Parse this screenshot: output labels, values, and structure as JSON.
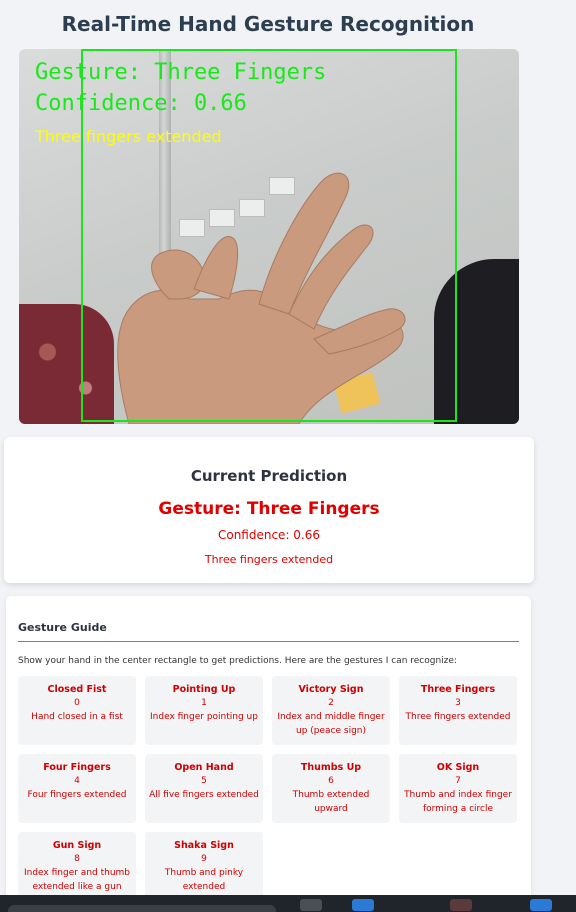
{
  "page": {
    "title": "Real-Time Hand Gesture Recognition"
  },
  "video": {
    "overlay_gesture": "Gesture: Three Fingers",
    "overlay_confidence": "Confidence: 0.66",
    "overlay_description": "Three fingers extended",
    "box_color": "#1de51d"
  },
  "prediction": {
    "heading": "Current Prediction",
    "gesture": "Gesture: Three Fingers",
    "confidence": "Confidence: 0.66",
    "description": "Three fingers extended",
    "accent_color": "#e00000"
  },
  "guide": {
    "title": "Gesture Guide",
    "intro": "Show your hand in the center rectangle to get predictions. Here are the gestures I can recognize:",
    "gestures": [
      {
        "name": "Closed Fist",
        "index": "0",
        "desc": "Hand closed in a fist"
      },
      {
        "name": "Pointing Up",
        "index": "1",
        "desc": "Index finger pointing up"
      },
      {
        "name": "Victory Sign",
        "index": "2",
        "desc": "Index and middle finger up (peace sign)"
      },
      {
        "name": "Three Fingers",
        "index": "3",
        "desc": "Three fingers extended"
      },
      {
        "name": "Four Fingers",
        "index": "4",
        "desc": "Four fingers extended"
      },
      {
        "name": "Open Hand",
        "index": "5",
        "desc": "All five fingers extended"
      },
      {
        "name": "Thumbs Up",
        "index": "6",
        "desc": "Thumb extended upward"
      },
      {
        "name": "OK Sign",
        "index": "7",
        "desc": "Thumb and index finger forming a circle"
      },
      {
        "name": "Gun Sign",
        "index": "8",
        "desc": "Index finger and thumb extended like a gun"
      },
      {
        "name": "Shaka Sign",
        "index": "9",
        "desc": "Thumb and pinky extended"
      }
    ]
  }
}
